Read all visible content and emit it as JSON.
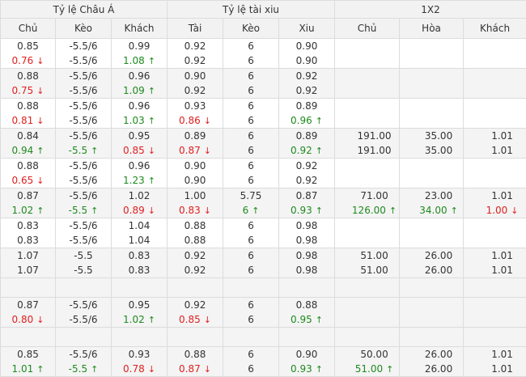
{
  "headers": {
    "groups": [
      "Tỷ lệ Châu Á",
      "Tỷ lệ tài xiu",
      "1X2"
    ],
    "columns": [
      "Chủ",
      "Kèo",
      "Khách",
      "Tài",
      "Kèo",
      "Xiu",
      "Chủ",
      "Hòa",
      "Khách"
    ]
  },
  "colors": {
    "up": "#1e8a1e",
    "down": "#e02020",
    "header_bg": "#f2f2f2",
    "alt_row_bg": "#f4f4f4",
    "border": "#dcdcdc"
  },
  "arrow_icons": {
    "up": "↑",
    "down": "↓"
  },
  "rows": [
    {
      "type": "data",
      "cells": [
        [
          "0.85",
          {
            "v": "0.76",
            "d": "down"
          }
        ],
        [
          "-5.5/6",
          "-5.5/6"
        ],
        [
          "0.99",
          {
            "v": "1.08",
            "d": "up"
          }
        ],
        [
          "0.92",
          "0.92"
        ],
        [
          "6",
          "6"
        ],
        [
          "0.90",
          "0.90"
        ],
        [],
        [],
        []
      ]
    },
    {
      "type": "data",
      "cells": [
        [
          "0.88",
          {
            "v": "0.75",
            "d": "down"
          }
        ],
        [
          "-5.5/6",
          "-5.5/6"
        ],
        [
          "0.96",
          {
            "v": "1.09",
            "d": "up"
          }
        ],
        [
          "0.90",
          "0.92"
        ],
        [
          "6",
          "6"
        ],
        [
          "0.92",
          "0.92"
        ],
        [],
        [],
        []
      ]
    },
    {
      "type": "data",
      "cells": [
        [
          "0.88",
          {
            "v": "0.81",
            "d": "down"
          }
        ],
        [
          "-5.5/6",
          "-5.5/6"
        ],
        [
          "0.96",
          {
            "v": "1.03",
            "d": "up"
          }
        ],
        [
          "0.93",
          {
            "v": "0.86",
            "d": "down"
          }
        ],
        [
          "6",
          "6"
        ],
        [
          "0.89",
          {
            "v": "0.96",
            "d": "up"
          }
        ],
        [],
        [],
        []
      ]
    },
    {
      "type": "data",
      "cells": [
        [
          "0.84",
          {
            "v": "0.94",
            "d": "up"
          }
        ],
        [
          "-5.5/6",
          {
            "v": "-5.5",
            "d": "up"
          }
        ],
        [
          "0.95",
          {
            "v": "0.85",
            "d": "down"
          }
        ],
        [
          "0.89",
          {
            "v": "0.87",
            "d": "down"
          }
        ],
        [
          "6",
          "6"
        ],
        [
          "0.89",
          {
            "v": "0.92",
            "d": "up"
          }
        ],
        [
          "191.00",
          "191.00"
        ],
        [
          "35.00",
          "35.00"
        ],
        [
          "1.01",
          "1.01"
        ]
      ]
    },
    {
      "type": "data",
      "cells": [
        [
          "0.88",
          {
            "v": "0.65",
            "d": "down"
          }
        ],
        [
          "-5.5/6",
          "-5.5/6"
        ],
        [
          "0.96",
          {
            "v": "1.23",
            "d": "up"
          }
        ],
        [
          "0.90",
          "0.90"
        ],
        [
          "6",
          "6"
        ],
        [
          "0.92",
          "0.92"
        ],
        [],
        [],
        []
      ]
    },
    {
      "type": "data",
      "cells": [
        [
          "0.87",
          {
            "v": "1.02",
            "d": "up"
          }
        ],
        [
          "-5.5/6",
          {
            "v": "-5.5",
            "d": "up"
          }
        ],
        [
          "1.02",
          {
            "v": "0.89",
            "d": "down"
          }
        ],
        [
          "1.00",
          {
            "v": "0.83",
            "d": "down"
          }
        ],
        [
          "5.75",
          {
            "v": "6",
            "d": "up"
          }
        ],
        [
          "0.87",
          {
            "v": "0.93",
            "d": "up"
          }
        ],
        [
          "71.00",
          {
            "v": "126.00",
            "d": "up"
          }
        ],
        [
          "23.00",
          {
            "v": "34.00",
            "d": "up"
          }
        ],
        [
          "1.01",
          {
            "v": "1.00",
            "d": "down"
          }
        ]
      ]
    },
    {
      "type": "data",
      "cells": [
        [
          "0.83",
          "0.83"
        ],
        [
          "-5.5/6",
          "-5.5/6"
        ],
        [
          "1.04",
          "1.04"
        ],
        [
          "0.88",
          "0.88"
        ],
        [
          "6",
          "6"
        ],
        [
          "0.98",
          "0.98"
        ],
        [],
        [],
        []
      ]
    },
    {
      "type": "data",
      "cells": [
        [
          "1.07",
          "1.07"
        ],
        [
          "-5.5",
          "-5.5"
        ],
        [
          "0.83",
          "0.83"
        ],
        [
          "0.92",
          "0.92"
        ],
        [
          "6",
          "6"
        ],
        [
          "0.98",
          "0.98"
        ],
        [
          "51.00",
          "51.00"
        ],
        [
          "26.00",
          "26.00"
        ],
        [
          "1.01",
          "1.01"
        ]
      ]
    },
    {
      "type": "gap"
    },
    {
      "type": "data",
      "cells": [
        [
          "0.87",
          {
            "v": "0.80",
            "d": "down"
          }
        ],
        [
          "-5.5/6",
          "-5.5/6"
        ],
        [
          "0.95",
          {
            "v": "1.02",
            "d": "up"
          }
        ],
        [
          "0.92",
          {
            "v": "0.85",
            "d": "down"
          }
        ],
        [
          "6",
          "6"
        ],
        [
          "0.88",
          {
            "v": "0.95",
            "d": "up"
          }
        ],
        [],
        [],
        []
      ]
    },
    {
      "type": "gap"
    },
    {
      "type": "data",
      "cells": [
        [
          "0.85",
          {
            "v": "1.01",
            "d": "up"
          }
        ],
        [
          "-5.5/6",
          {
            "v": "-5.5",
            "d": "up"
          }
        ],
        [
          "0.93",
          {
            "v": "0.78",
            "d": "down"
          }
        ],
        [
          "0.88",
          {
            "v": "0.87",
            "d": "down"
          }
        ],
        [
          "6",
          "6"
        ],
        [
          "0.90",
          {
            "v": "0.93",
            "d": "up"
          }
        ],
        [
          "50.00",
          {
            "v": "51.00",
            "d": "up"
          }
        ],
        [
          "26.00",
          "26.00"
        ],
        [
          "1.01",
          "1.01"
        ]
      ]
    }
  ]
}
